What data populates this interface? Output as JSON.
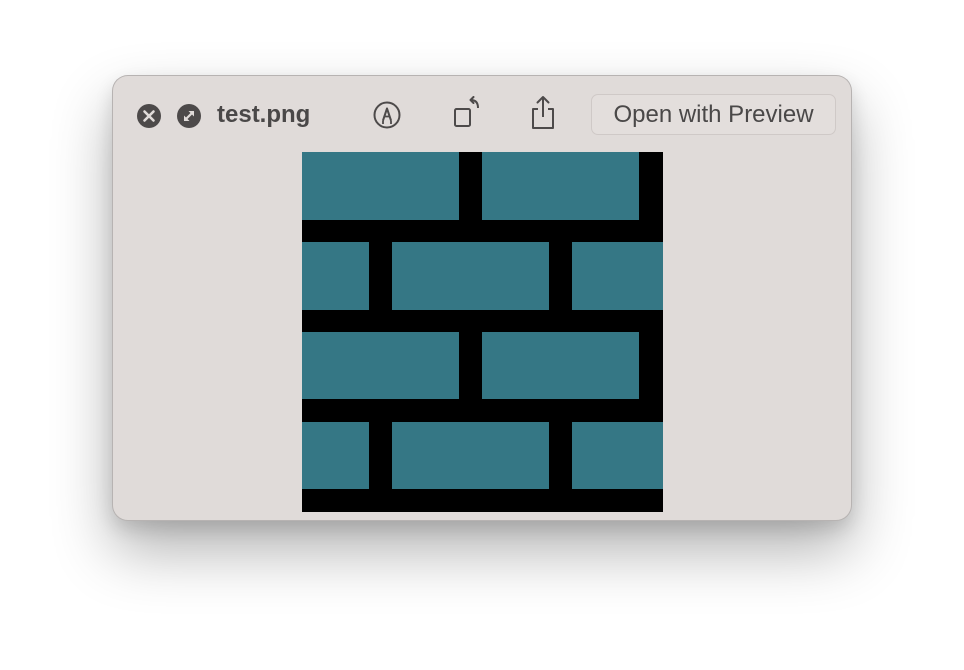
{
  "window": {
    "file_name": "test.png",
    "open_with_label": "Open with Preview"
  },
  "toolbar": {
    "close_icon": "close-circle-icon",
    "fullscreen_icon": "fullscreen-circle-icon",
    "markup_icon": "markup-pen-icon",
    "rotate_icon": "rotate-icon",
    "share_icon": "share-icon"
  },
  "preview": {
    "description_colors": {
      "brick": "#357785",
      "mortar": "#000000"
    }
  },
  "colors": {
    "window_bg": "#e0dbd9",
    "text": "#4a4848",
    "icon": "#4d4a4a"
  }
}
